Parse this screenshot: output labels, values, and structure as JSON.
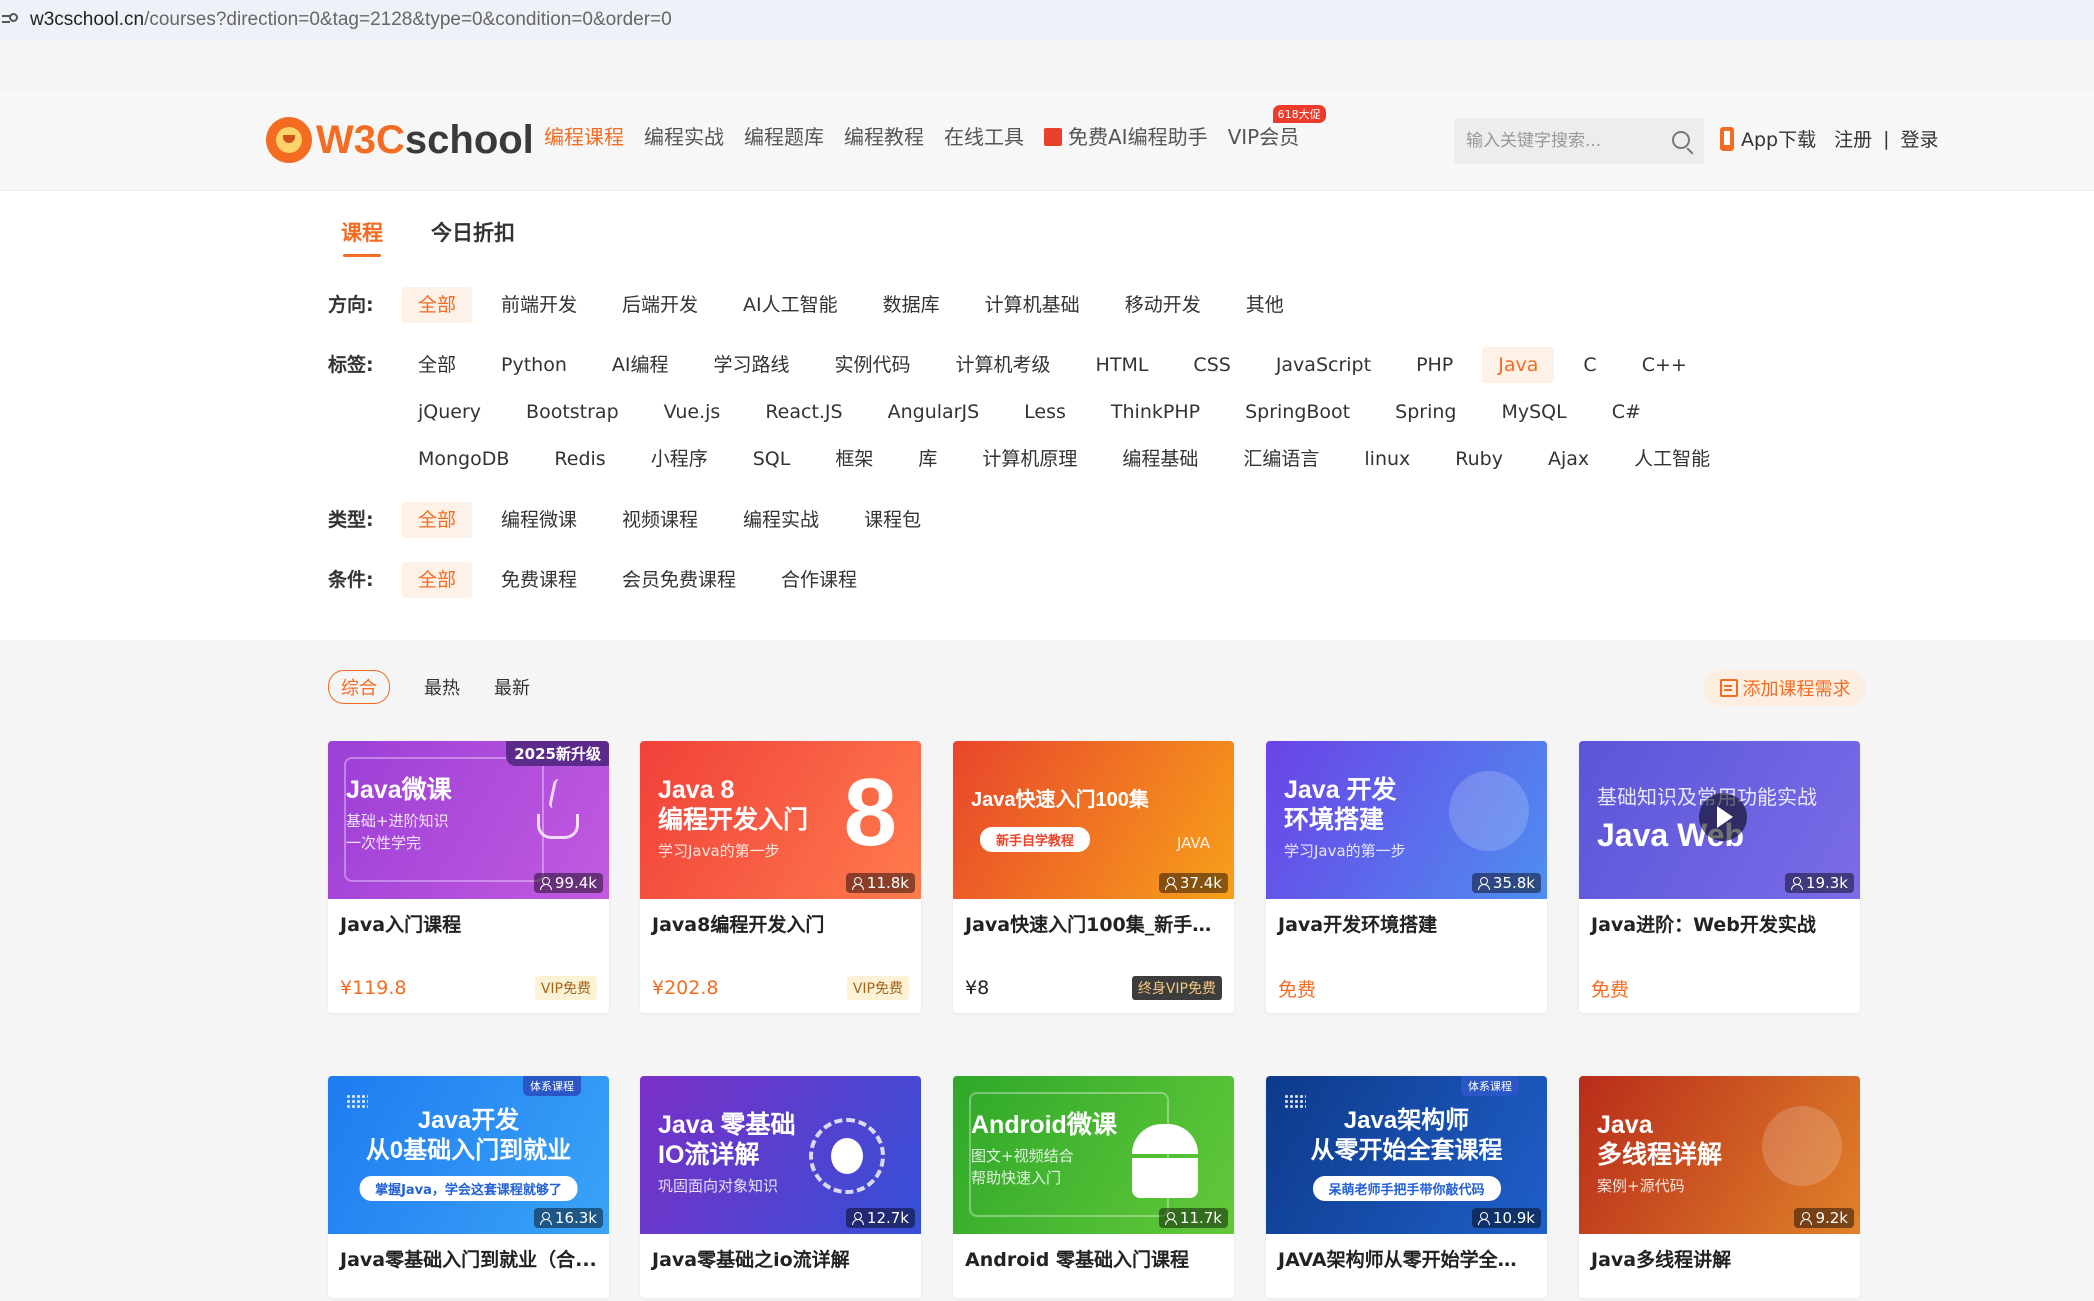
{
  "browser": {
    "url_host": "w3cschool.cn",
    "url_path": "/courses?direction=0&tag=2128&type=0&condition=0&order=0"
  },
  "header": {
    "logo_w3": "W3C",
    "logo_rest": "school",
    "nav": [
      {
        "label": "编程课程",
        "active": true
      },
      {
        "label": "编程实战",
        "active": false
      },
      {
        "label": "编程题库",
        "active": false
      },
      {
        "label": "编程教程",
        "active": false
      },
      {
        "label": "在线工具",
        "active": false
      },
      {
        "label": "免费AI编程助手",
        "active": false
      },
      {
        "label": "VIP会员",
        "active": false
      }
    ],
    "vip_promo": "618大促",
    "search_placeholder": "输入关键字搜索...",
    "app_download": "App下载",
    "register": "注册",
    "divider": "|",
    "login": "登录"
  },
  "tabs": [
    {
      "label": "课程",
      "active": true
    },
    {
      "label": "今日折扣",
      "active": false
    }
  ],
  "filters": {
    "direction": {
      "label": "方向:",
      "options": [
        "全部",
        "前端开发",
        "后端开发",
        "AI人工智能",
        "数据库",
        "计算机基础",
        "移动开发",
        "其他"
      ],
      "selected": "全部"
    },
    "tags": {
      "label": "标签:",
      "options": [
        "全部",
        "Python",
        "AI编程",
        "学习路线",
        "实例代码",
        "计算机考级",
        "HTML",
        "CSS",
        "JavaScript",
        "PHP",
        "Java",
        "C",
        "C++",
        "jQuery",
        "Bootstrap",
        "Vue.js",
        "React.JS",
        "AngularJS",
        "Less",
        "ThinkPHP",
        "SpringBoot",
        "Spring",
        "MySQL",
        "C#",
        "MongoDB",
        "Redis",
        "小程序",
        "SQL",
        "框架",
        "库",
        "计算机原理",
        "编程基础",
        "汇编语言",
        "linux",
        "Ruby",
        "Ajax",
        "人工智能"
      ],
      "selected": "Java"
    },
    "type": {
      "label": "类型:",
      "options": [
        "全部",
        "编程微课",
        "视频课程",
        "编程实战",
        "课程包"
      ],
      "selected": "全部"
    },
    "condition": {
      "label": "条件:",
      "options": [
        "全部",
        "免费课程",
        "会员免费课程",
        "合作课程"
      ],
      "selected": "全部"
    }
  },
  "sort": {
    "options": [
      "综合",
      "最热",
      "最新"
    ],
    "selected": "综合",
    "add_request": "添加课程需求"
  },
  "courses": [
    {
      "thumb_title": "Java微课",
      "thumb_sub1": "基础+进阶知识",
      "thumb_sub2": "一次性学完",
      "corner": "2025新升级",
      "learners": "99.4k",
      "title": "Java入门课程",
      "price": "¥119.8",
      "tag": "VIP免费",
      "bg1": "#9b3fd6",
      "bg2": "#c35ae0"
    },
    {
      "thumb_title": "Java 8",
      "thumb_title2": "编程开发入门",
      "thumb_sub1": "学习Java的第一步",
      "big": "8",
      "learners": "11.8k",
      "title": "Java8编程开发入门",
      "price": "¥202.8",
      "tag": "VIP免费",
      "bg1": "#f0413a",
      "bg2": "#ff7b4d"
    },
    {
      "thumb_title": "Java快速入门100集",
      "pill": "新手自学教程",
      "side": "JAVA",
      "learners": "37.4k",
      "title": "Java快速入门100集_新手自...",
      "price": "¥8",
      "tag": "终身VIP免费",
      "bg1": "#e8452c",
      "bg2": "#f7a11a"
    },
    {
      "thumb_title": "Java 开发",
      "thumb_title2": "环境搭建",
      "thumb_sub1": "学习Java的第一步",
      "learners": "35.8k",
      "title": "Java开发环境搭建",
      "price": "免费",
      "bg1": "#6a43e6",
      "bg2": "#4f8ef0"
    },
    {
      "thumb_sub1": "基础知识及常用功能实战",
      "thumb_title": "Java Web",
      "learners": "19.3k",
      "title": "Java进阶：Web开发实战",
      "price": "免费",
      "bg1": "#5a56d8",
      "bg2": "#7b6ce8"
    },
    {
      "sys": "体系课程",
      "thumb_title": "Java开发",
      "thumb_title2": "从0基础入门到就业",
      "pill": "掌握Java，学会这套课程就够了",
      "learners": "16.3k",
      "title": "Java零基础入门到就业（合...",
      "bg1": "#1f7bf0",
      "bg2": "#3aa4f7"
    },
    {
      "thumb_title": "Java 零基础",
      "thumb_title2": "IO流详解",
      "thumb_sub1": "巩固面向对象知识",
      "learners": "12.7k",
      "title": "Java零基础之io流详解",
      "bg1": "#7a2fc6",
      "bg2": "#3550d6"
    },
    {
      "thumb_title": "Android微课",
      "thumb_sub1": "图文+视频结合",
      "thumb_sub2": "帮助快速入门",
      "learners": "11.7k",
      "title": "Android 零基础入门课程",
      "bg1": "#2fa82a",
      "bg2": "#63c93a"
    },
    {
      "sys": "体系课程",
      "thumb_title": "Java架构师",
      "thumb_title2": "从零开始全套课程",
      "pill": "呆萌老师手把手带你敲代码",
      "learners": "10.9k",
      "title": "JAVA架构师从零开始学全套...",
      "bg1": "#0d3a8a",
      "bg2": "#1f5fc9"
    },
    {
      "thumb_title": "Java",
      "thumb_title2": "多线程详解",
      "thumb_sub1": "案例+源代码",
      "learners": "9.2k",
      "title": "Java多线程讲解",
      "bg1": "#b82c1a",
      "bg2": "#e0822a"
    }
  ]
}
